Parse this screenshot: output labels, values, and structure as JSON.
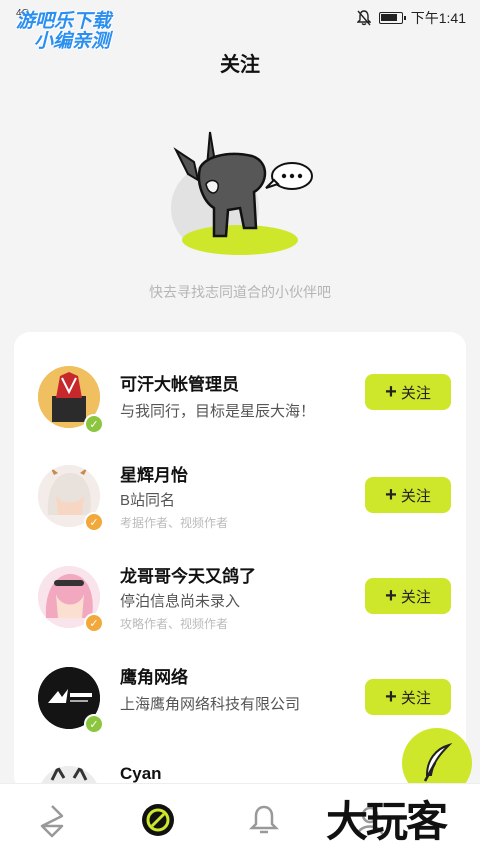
{
  "status_bar": {
    "network": "4G",
    "watermark_line1": "游吧乐下载",
    "watermark_line2": "小编亲测",
    "time": "下午1:41",
    "battery_level": 0.85
  },
  "header": {
    "title": "关注"
  },
  "empty_state": {
    "hint": "快去寻找志同道合的小伙伴吧"
  },
  "recommend_list": [
    {
      "name": "可汗大帐管理员",
      "subtitle": "与我同行，目标是星辰大海！",
      "tag": "",
      "badge": "✓",
      "badge_color": "#8cc63f",
      "button": "关注"
    },
    {
      "name": "星辉月怡",
      "subtitle": "B站同名",
      "tag": "考据作者、视频作者",
      "badge": "✓",
      "badge_color": "#f2a93b",
      "button": "关注"
    },
    {
      "name": "龙哥哥今天又鸽了",
      "subtitle": "停泊信息尚未录入",
      "tag": "攻略作者、视频作者",
      "badge": "✓",
      "badge_color": "#f2a93b",
      "button": "关注"
    },
    {
      "name": "鹰角网络",
      "subtitle": "上海鹰角网络科技有限公司",
      "tag": "",
      "badge": "✓",
      "badge_color": "#8cc63f",
      "button": "关注"
    },
    {
      "name": "Cyan",
      "subtitle": "",
      "tag": "",
      "badge": "",
      "badge_color": "",
      "button": ""
    }
  ],
  "brand_overlay": "大玩客",
  "accent_color": "#cfe72b",
  "nav": {
    "items": [
      "home-icon",
      "discover-icon",
      "notification-icon",
      "profile-icon"
    ],
    "active": "discover-icon"
  }
}
